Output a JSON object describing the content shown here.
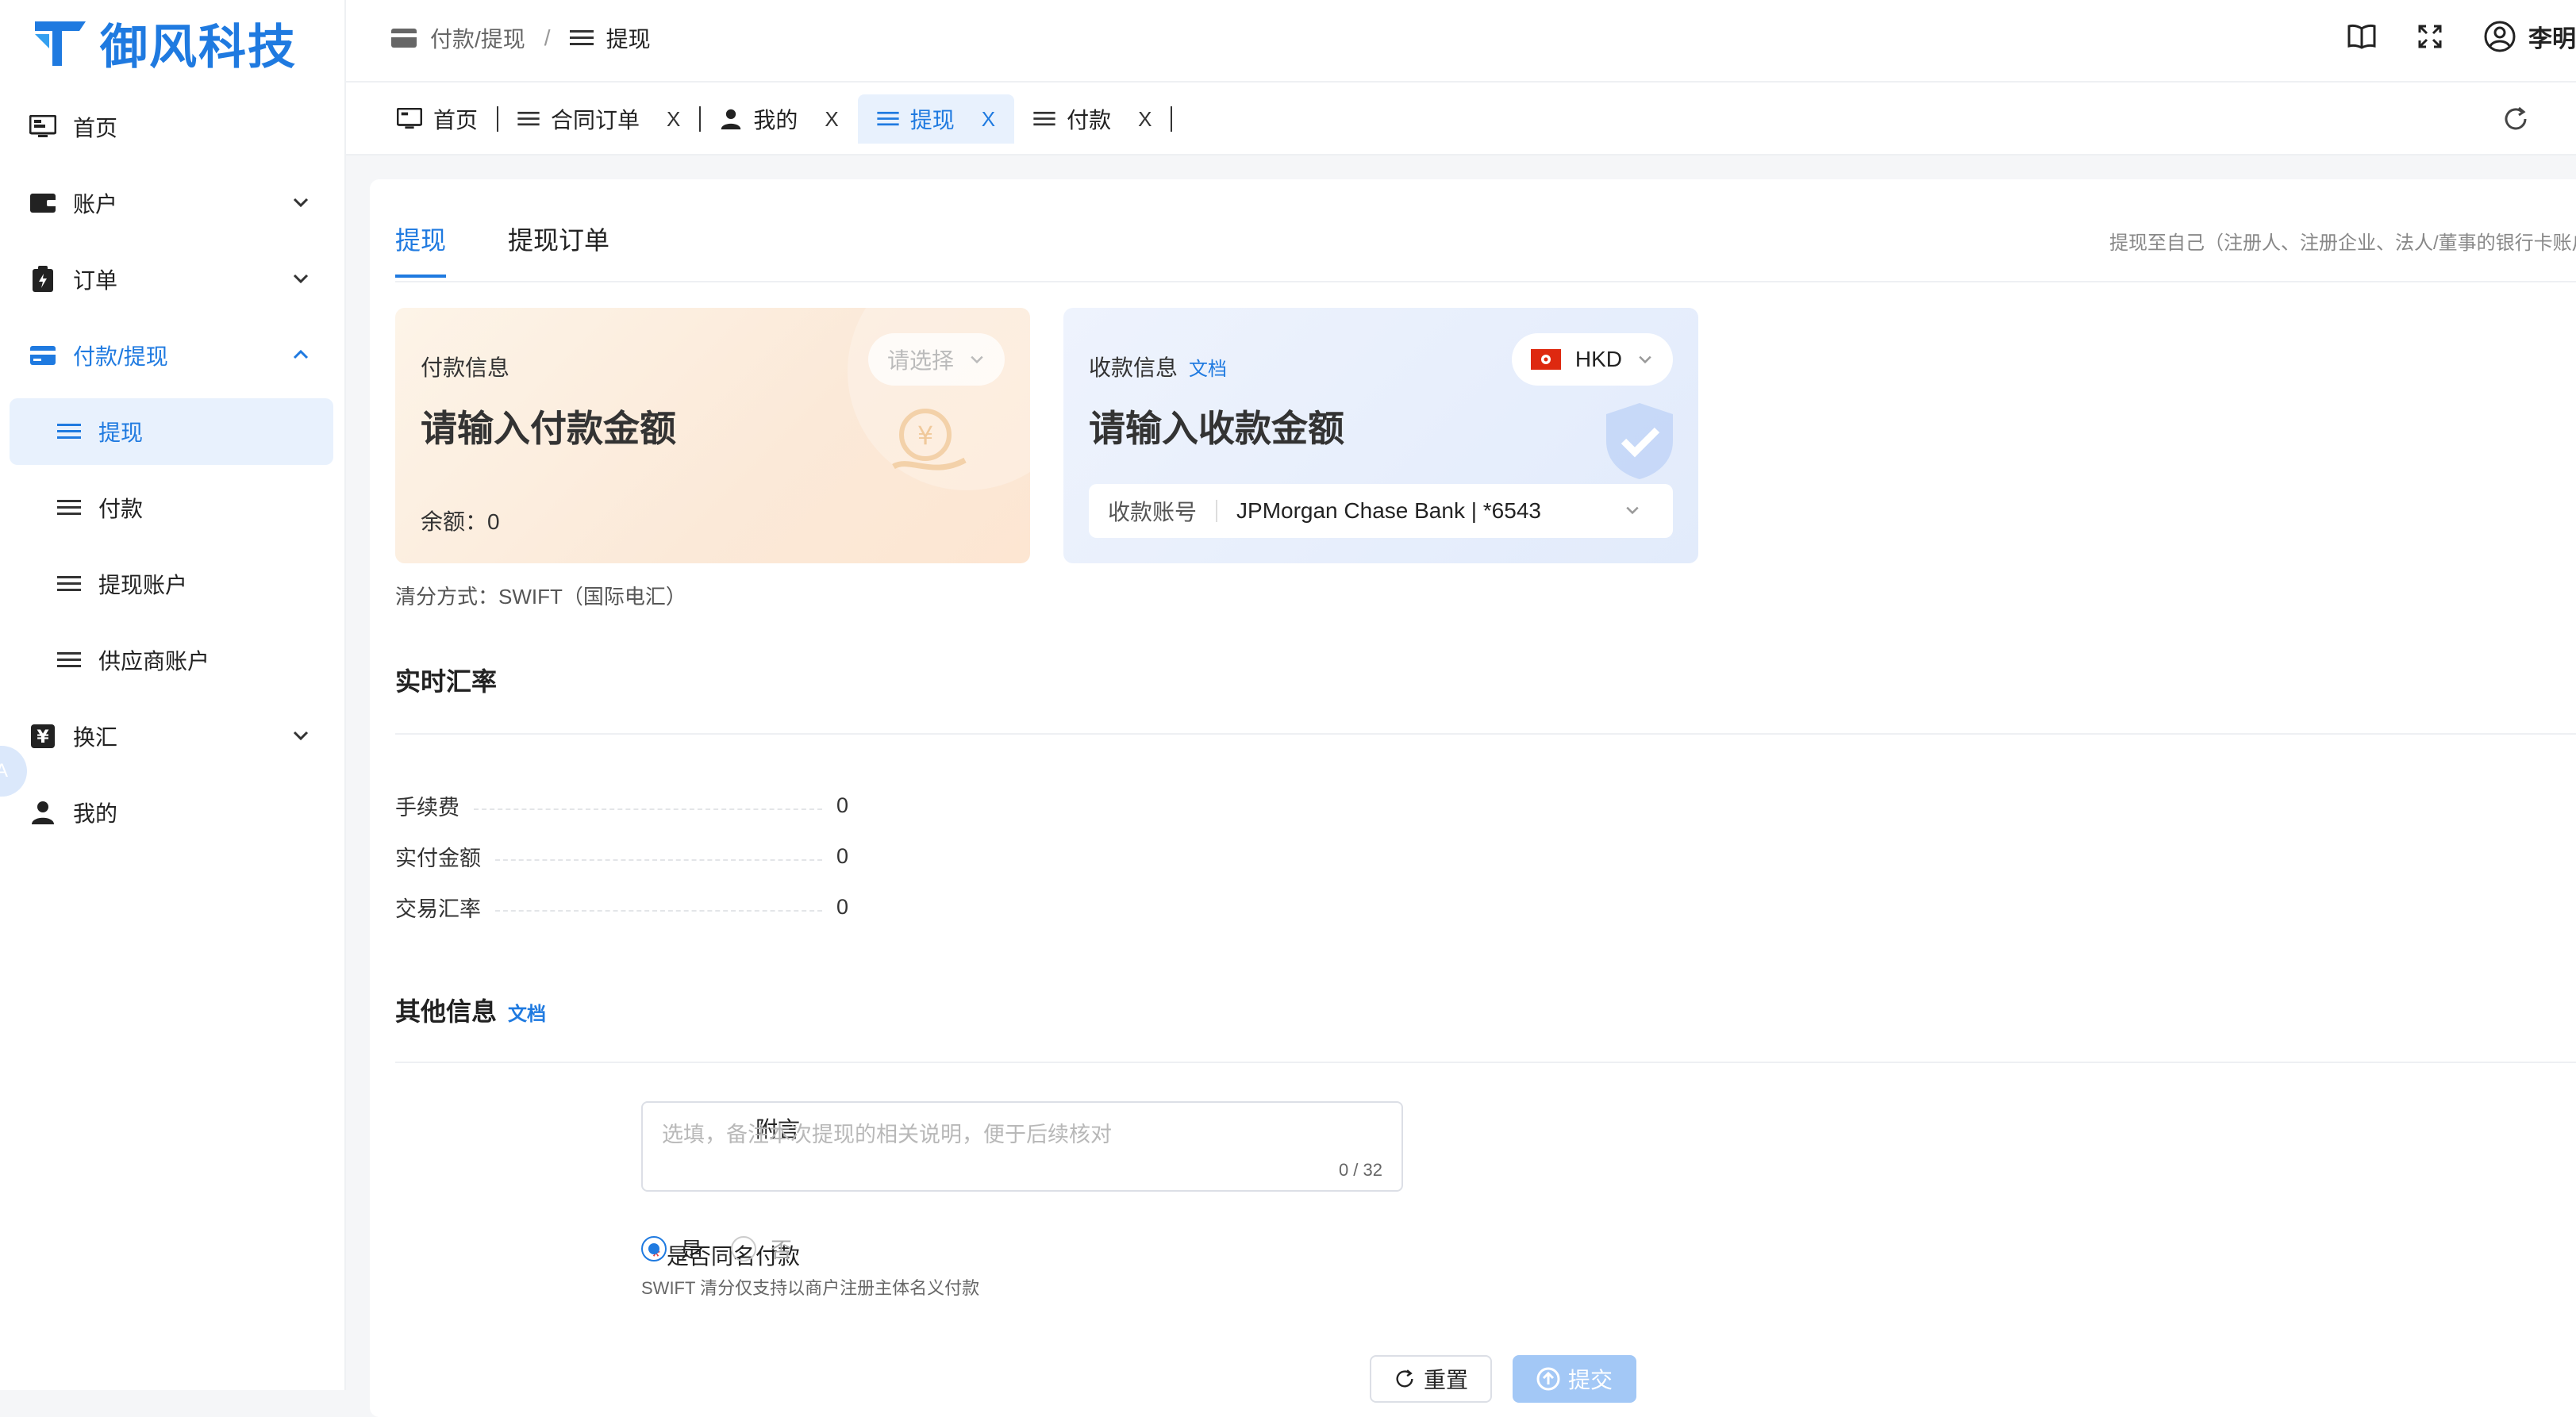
{
  "brand": {
    "name": "御风科技",
    "color": "#1f7ae0"
  },
  "sidebar": {
    "items": [
      {
        "label": "首页",
        "icon": "monitor-icon"
      },
      {
        "label": "账户",
        "icon": "wallet-icon"
      },
      {
        "label": "订单",
        "icon": "clipboard-icon"
      },
      {
        "label": "付款/提现",
        "icon": "card-icon",
        "open": true
      },
      {
        "label": "换汇",
        "icon": "yen-icon"
      },
      {
        "label": "我的",
        "icon": "user-icon"
      }
    ],
    "sub_items": [
      {
        "label": "提现",
        "active": true
      },
      {
        "label": "付款"
      },
      {
        "label": "提现账户"
      },
      {
        "label": "供应商账户"
      }
    ],
    "bubble": "A"
  },
  "breadcrumb": {
    "parent": "付款/提现",
    "separator": "/",
    "current": "提现"
  },
  "header": {
    "user": "李明（已审核"
  },
  "tabs": [
    {
      "label": "首页",
      "icon": "monitor-icon"
    },
    {
      "label": "合同订单",
      "icon": "menu-icon",
      "close": "X"
    },
    {
      "label": "我的",
      "icon": "user-icon",
      "close": "X"
    },
    {
      "label": "提现",
      "icon": "menu-icon",
      "close": "X",
      "active": true
    },
    {
      "label": "付款",
      "icon": "menu-icon",
      "close": "X"
    }
  ],
  "page": {
    "tabs": [
      "提现",
      "提现订单"
    ],
    "hint": "提现至自己（注册人、注册企业、法人/董事的银行卡账户",
    "pay": {
      "label": "付款信息",
      "select_placeholder": "请选择",
      "amount_placeholder": "请输入付款金额",
      "balance": "余额：0"
    },
    "receive": {
      "label": "收款信息",
      "doc": "文档",
      "currency": "HKD",
      "amount_placeholder": "请输入收款金额",
      "account_label": "收款账号",
      "account_value": "JPMorgan Chase Bank | *6543"
    },
    "clearing": "清分方式：SWIFT（国际电汇）",
    "rate_section": "实时汇率",
    "rows": [
      {
        "k": "手续费",
        "v": "0"
      },
      {
        "k": "实付金额",
        "v": "0"
      },
      {
        "k": "交易汇率",
        "v": "0"
      }
    ],
    "other_section": "其他信息",
    "other_doc": "文档",
    "remark_label": "附言",
    "remark_placeholder": "选填，备注本次提现的相关说明，便于后续核对",
    "remark_count": "0 / 32",
    "same_name_label": "是否同名付款",
    "same_name_required": "*",
    "yes": "是",
    "no": "否",
    "same_name_note": "SWIFT 清分仅支持以商户注册主体名义付款",
    "reset": "重置",
    "submit": "提交"
  }
}
